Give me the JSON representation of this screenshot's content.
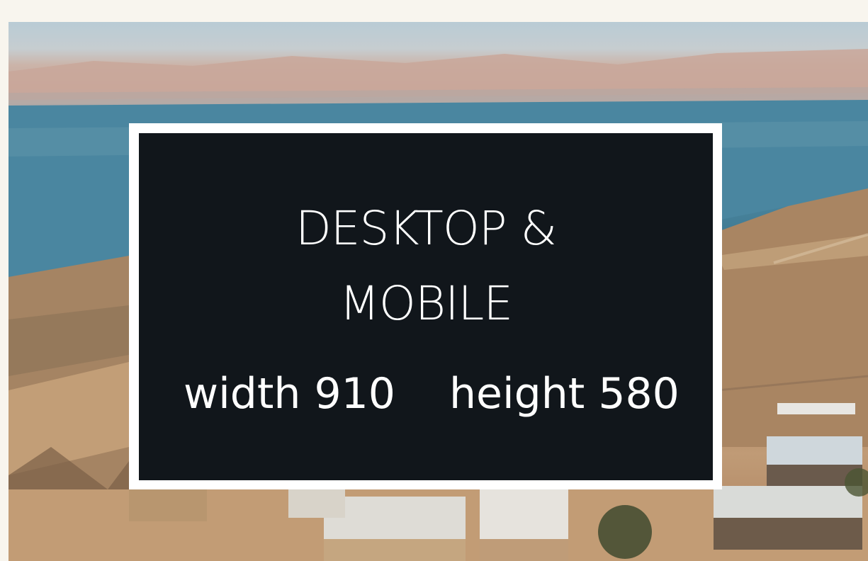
{
  "photo": {
    "subject": "aerial view over desert buildings toward a lake and mountains"
  },
  "overlay": {
    "title_line1": "DESKTOP &",
    "title_line2": "MOBILE",
    "width_text": "width 910",
    "height_text": "height 580"
  },
  "colors": {
    "page_background": "#f8f5ee",
    "card_background": "#11161b",
    "card_border": "#ffffff",
    "text": "#ffffff"
  }
}
